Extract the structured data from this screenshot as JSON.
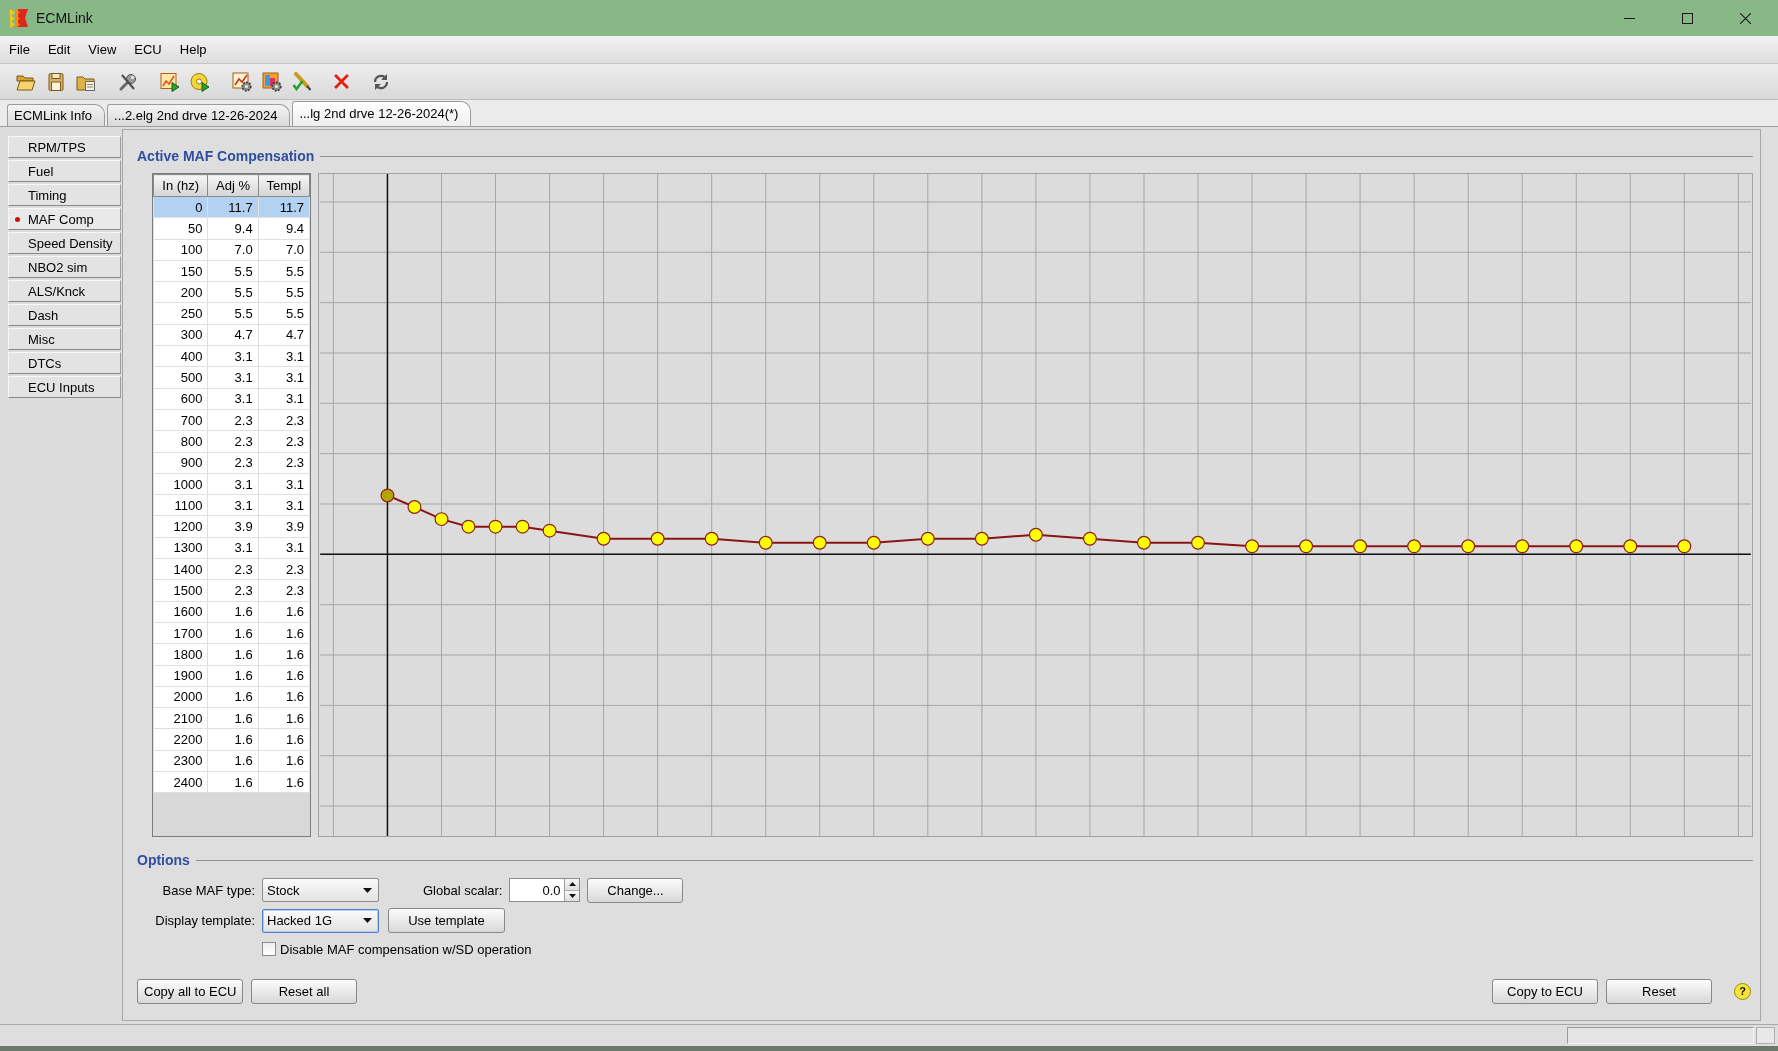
{
  "window": {
    "title": "ECMLink"
  },
  "menu": [
    "File",
    "Edit",
    "View",
    "ECU",
    "Help"
  ],
  "tabs": [
    {
      "label": "ECMLink Info",
      "selected": false
    },
    {
      "label": "...2.elg 2nd drve 12-26-2024",
      "selected": false
    },
    {
      "label": "...lg 2nd drve 12-26-2024(*)",
      "selected": true
    }
  ],
  "sidebar": {
    "items": [
      {
        "label": "RPM/TPS",
        "selected": false
      },
      {
        "label": "Fuel",
        "selected": false
      },
      {
        "label": "Timing",
        "selected": false
      },
      {
        "label": "MAF Comp",
        "selected": true
      },
      {
        "label": "Speed Density",
        "selected": false
      },
      {
        "label": "NBO2 sim",
        "selected": false
      },
      {
        "label": "ALS/Knck",
        "selected": false
      },
      {
        "label": "Dash",
        "selected": false
      },
      {
        "label": "Misc",
        "selected": false
      },
      {
        "label": "DTCs",
        "selected": false
      },
      {
        "label": "ECU Inputs",
        "selected": false
      }
    ]
  },
  "maf_compensation": {
    "title": "Active MAF Compensation",
    "table": {
      "columns": [
        "In (hz)",
        "Adj %",
        "Templ"
      ],
      "rows": [
        {
          "cells": [
            "0",
            "11.7",
            "11.7"
          ],
          "selected": true
        },
        {
          "cells": [
            "50",
            "9.4",
            "9.4"
          ],
          "selected": false
        },
        {
          "cells": [
            "100",
            "7.0",
            "7.0"
          ],
          "selected": false
        },
        {
          "cells": [
            "150",
            "5.5",
            "5.5"
          ],
          "selected": false
        },
        {
          "cells": [
            "200",
            "5.5",
            "5.5"
          ],
          "selected": false
        },
        {
          "cells": [
            "250",
            "5.5",
            "5.5"
          ],
          "selected": false
        },
        {
          "cells": [
            "300",
            "4.7",
            "4.7"
          ],
          "selected": false
        },
        {
          "cells": [
            "400",
            "3.1",
            "3.1"
          ],
          "selected": false
        },
        {
          "cells": [
            "500",
            "3.1",
            "3.1"
          ],
          "selected": false
        },
        {
          "cells": [
            "600",
            "3.1",
            "3.1"
          ],
          "selected": false
        },
        {
          "cells": [
            "700",
            "2.3",
            "2.3"
          ],
          "selected": false
        },
        {
          "cells": [
            "800",
            "2.3",
            "2.3"
          ],
          "selected": false
        },
        {
          "cells": [
            "900",
            "2.3",
            "2.3"
          ],
          "selected": false
        },
        {
          "cells": [
            "1000",
            "3.1",
            "3.1"
          ],
          "selected": false
        },
        {
          "cells": [
            "1100",
            "3.1",
            "3.1"
          ],
          "selected": false
        },
        {
          "cells": [
            "1200",
            "3.9",
            "3.9"
          ],
          "selected": false
        },
        {
          "cells": [
            "1300",
            "3.1",
            "3.1"
          ],
          "selected": false
        },
        {
          "cells": [
            "1400",
            "2.3",
            "2.3"
          ],
          "selected": false
        },
        {
          "cells": [
            "1500",
            "2.3",
            "2.3"
          ],
          "selected": false
        },
        {
          "cells": [
            "1600",
            "1.6",
            "1.6"
          ],
          "selected": false
        },
        {
          "cells": [
            "1700",
            "1.6",
            "1.6"
          ],
          "selected": false
        },
        {
          "cells": [
            "1800",
            "1.6",
            "1.6"
          ],
          "selected": false
        },
        {
          "cells": [
            "1900",
            "1.6",
            "1.6"
          ],
          "selected": false
        },
        {
          "cells": [
            "2000",
            "1.6",
            "1.6"
          ],
          "selected": false
        },
        {
          "cells": [
            "2100",
            "1.6",
            "1.6"
          ],
          "selected": false
        },
        {
          "cells": [
            "2200",
            "1.6",
            "1.6"
          ],
          "selected": false
        },
        {
          "cells": [
            "2300",
            "1.6",
            "1.6"
          ],
          "selected": false
        },
        {
          "cells": [
            "2400",
            "1.6",
            "1.6"
          ],
          "selected": false
        }
      ]
    }
  },
  "options": {
    "title": "Options",
    "base_maf_type": {
      "label": "Base MAF type:",
      "value": "Stock",
      "focused": false
    },
    "global_scalar": {
      "label": "Global scalar:",
      "value": "0.0"
    },
    "change_button": "Change...",
    "display_template": {
      "label": "Display template:",
      "value": "Hacked 1G",
      "focused": true
    },
    "use_template_button": "Use template",
    "disable_sd": {
      "label": "Disable MAF compensation w/SD operation",
      "checked": false
    }
  },
  "actions": {
    "left": [
      "Copy all to ECU",
      "Reset all"
    ],
    "right": [
      "Copy to ECU",
      "Reset"
    ],
    "help": "?"
  }
}
